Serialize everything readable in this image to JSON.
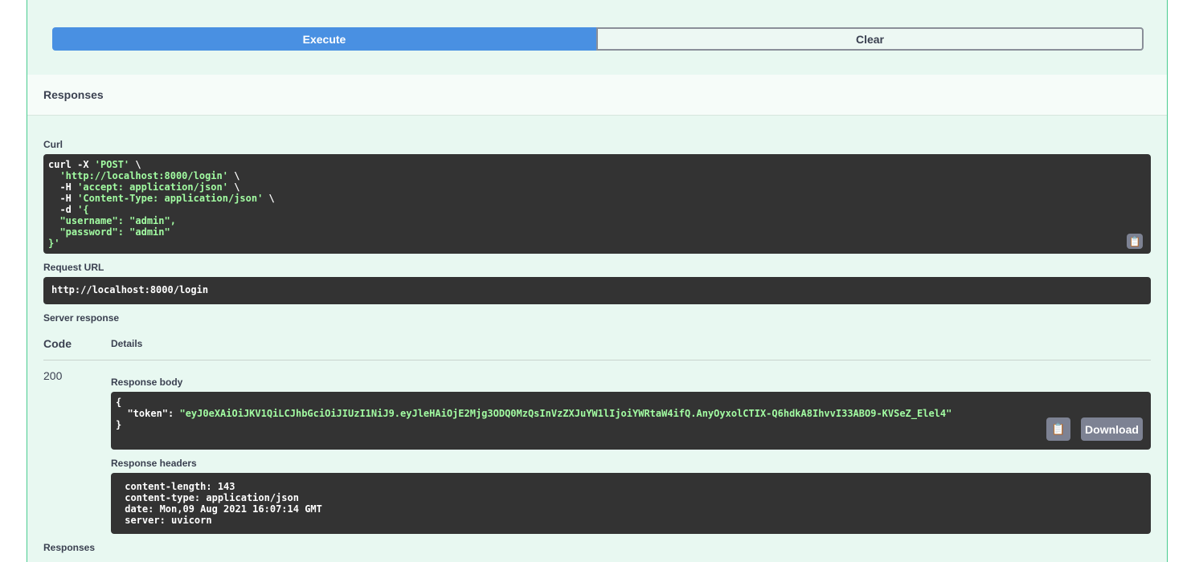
{
  "buttons": {
    "execute": "Execute",
    "clear": "Clear"
  },
  "responses_title": "Responses",
  "curl": {
    "label": "Curl",
    "l1a": "curl -X ",
    "l1b": "'POST'",
    "l1c": " \\",
    "l2": "  'http://localhost:8000/login'",
    "l2c": " \\",
    "l3a": "  -H ",
    "l3b": "'accept: application/json'",
    "l3c": " \\",
    "l4a": "  -H ",
    "l4b": "'Content-Type: application/json'",
    "l4c": " \\",
    "l5a": "  -d ",
    "l5b": "'{",
    "l6": "  \"username\": \"admin\",",
    "l7": "  \"password\": \"admin\"",
    "l8": "}'"
  },
  "request_url": {
    "label": "Request URL",
    "value": "http://localhost:8000/login"
  },
  "server_response": {
    "label": "Server response",
    "code_header": "Code",
    "details_header": "Details",
    "code": "200",
    "body_label": "Response body",
    "body_open": "{",
    "token_key": "  \"token\": ",
    "token_value": "\"eyJ0eXAiOiJKV1QiLCJhbGciOiJIUzI1NiJ9.eyJleHAiOjE2Mjg3ODQ0MzQsInVzZXJuYW1lIjoiYWRtaW4ifQ.AnyOyxolCTIX-Q6hdkA8IhvvI33ABO9-KVSeZ_Elel4\"",
    "body_close": "}",
    "download": "Download",
    "headers_label": "Response headers",
    "headers": [
      " content-length: 143",
      " content-type: application/json",
      " date: Mon,09 Aug 2021 16:07:14 GMT",
      " server: uvicorn"
    ]
  },
  "responses_footer": "Responses"
}
